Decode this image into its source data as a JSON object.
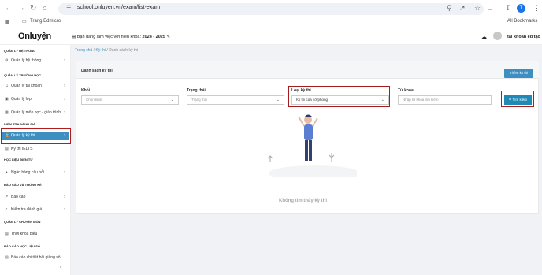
{
  "browser": {
    "url": "school.onluyen.vn/exam/list-exam",
    "bookmark_home": "Trang Edmicro",
    "all_bookmarks": "All Bookmarks",
    "profile_initial": "T"
  },
  "header": {
    "logo": "Onluyện",
    "school_year_label": "Bạn đang làm việc với niên khóa:",
    "school_year_value": "2024 - 2025",
    "account_name": "tài khoản ed tạo"
  },
  "sidebar": {
    "sections": [
      {
        "title": "QUẢN LÝ HỆ THỐNG"
      },
      {
        "title": "QUẢN LÝ TRƯỜNG HỌC"
      },
      {
        "title": "KIỂM TRA ĐÁNH GIÁ"
      },
      {
        "title": "HỌC LIỆU ĐIỆN TỬ"
      },
      {
        "title": "BÁO CÁO VÀ THỐNG KÊ"
      },
      {
        "title": "QUẢN LÝ CHUYÊN MÔN"
      },
      {
        "title": "BÁO CÁO HỌC LIỆU SỐ"
      }
    ],
    "items": [
      {
        "label": "Quản lý hệ thống"
      },
      {
        "label": "Quản lý tài khoản"
      },
      {
        "label": "Quản lý lớp"
      },
      {
        "label": "Quản lý môn học - giáo trình"
      },
      {
        "label": "Quản lý kỳ thi"
      },
      {
        "label": "Kỳ thi IELTS"
      },
      {
        "label": "Ngân hàng câu hỏi"
      },
      {
        "label": "Báo cáo"
      },
      {
        "label": "Kiểm tra đánh giá"
      },
      {
        "label": "Thời khóa biểu"
      },
      {
        "label": "Báo cáo chi tiết bài giảng số"
      }
    ]
  },
  "breadcrumb": {
    "home": "Trang chủ",
    "sep": "/",
    "exam": "Kỳ thi",
    "current": "Danh sách kỳ thi"
  },
  "card": {
    "title": "Danh sách kỳ thi",
    "add_button": "Thêm kỳ thi"
  },
  "filters": {
    "grade_label": "Khối",
    "grade_placeholder": "Chọn khối",
    "status_label": "Trạng thái",
    "status_placeholder": "Trạng thái",
    "type_label": "Loại kỳ thi",
    "type_value": "Kỳ thi của sở/phòng",
    "keyword_label": "Từ khóa",
    "keyword_placeholder": "Nhập từ khóa tìm kiếm",
    "search_button": "Tìm kiếm"
  },
  "empty_text": "Không tìm thấy kỳ thi",
  "colors": {
    "accent": "#3d8fc1",
    "highlight": "#b11d1d"
  }
}
